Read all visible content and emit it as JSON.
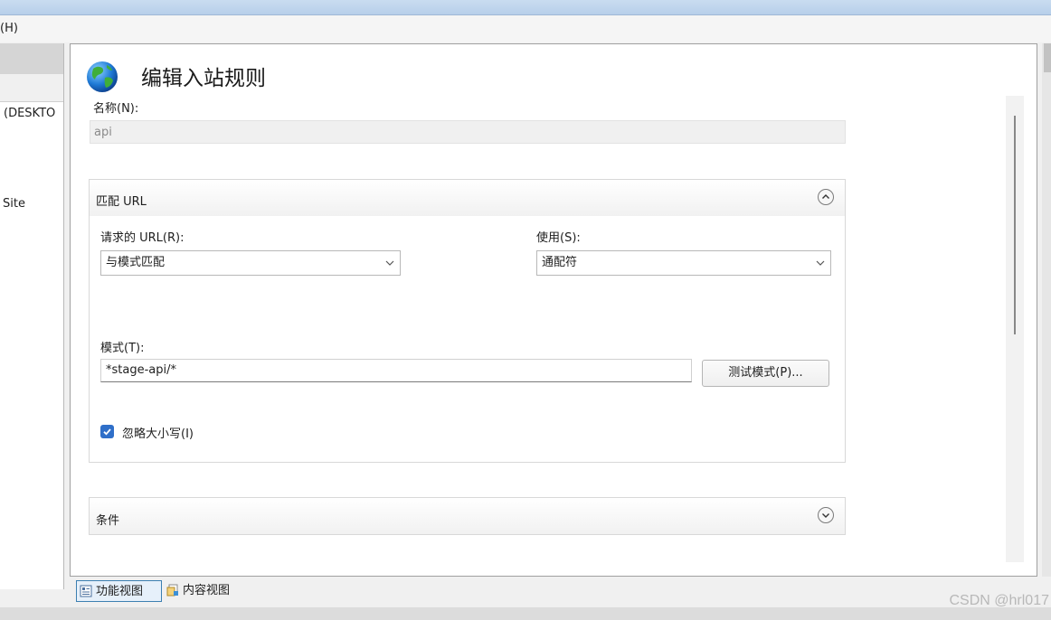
{
  "menubar": {
    "help_label": "(H)"
  },
  "left_panel": {
    "connection_text": "(DESKTO",
    "site_text": "Site"
  },
  "main": {
    "title": "编辑入站规则",
    "name_label": "名称(N):",
    "name_value": "api"
  },
  "match_url": {
    "section_title": "匹配 URL",
    "requested_url_label": "请求的 URL(R):",
    "requested_url_value": "与模式匹配",
    "using_label": "使用(S):",
    "using_value": "通配符",
    "pattern_label": "模式(T):",
    "pattern_value": "*stage-api/*",
    "test_pattern_button": "测试模式(P)...",
    "ignore_case_label": "忽略大小写(I)",
    "ignore_case_checked": true
  },
  "conditions": {
    "section_title": "条件"
  },
  "bottom_tabs": {
    "features_view": "功能视图",
    "content_view": "内容视图"
  },
  "watermark": "CSDN @hrl017",
  "colors": {
    "accent": "#2f6fc9",
    "panel_border": "#a0a0a0",
    "placeholder_text": "#8a8a8a"
  },
  "icons": [
    "globe-icon",
    "chevron-up-icon",
    "chevron-down-icon",
    "dropdown-arrow-icon",
    "checkmark-icon",
    "features-view-icon",
    "content-view-icon"
  ]
}
